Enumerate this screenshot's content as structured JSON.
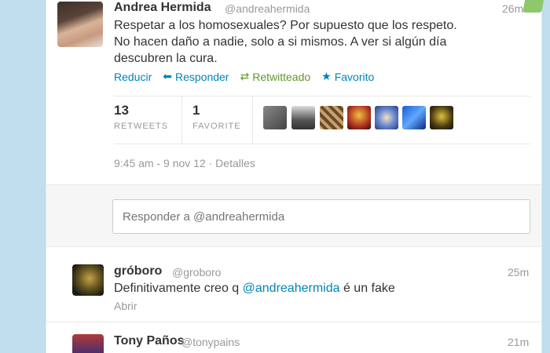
{
  "main_tweet": {
    "name": "Andrea Hermida",
    "handle": "@andreahermida",
    "time": "26m",
    "text_line1": "Respetar a los homosexuales? Por supuesto que los respeto.",
    "text_line2": "No hacen daño a nadie, solo a si mismos. A ver si algún día",
    "text_line3": "descubren la cura.",
    "actions": {
      "collapse": "Reducir",
      "reply": "Responder",
      "retweeted": "Retwitteado",
      "favorite": "Favorito"
    },
    "stats": {
      "retweets_count": "13",
      "retweets_label": "RETWEETS",
      "favorites_count": "1",
      "favorites_label": "FAVORITE"
    },
    "meta": "9:45 am - 9 nov 12 · Detalles"
  },
  "reply_box": {
    "placeholder": "Responder a @andreahermida"
  },
  "replies": [
    {
      "name": "gróboro",
      "handle": "@groboro",
      "time": "25m",
      "text_before": "Definitivamente creo q ",
      "mention": "@andreahermida",
      "text_after": " é un fake",
      "open": "Abrir"
    },
    {
      "name": "Tony Paños",
      "handle": "@tonypains",
      "time": "21m"
    }
  ],
  "colors": {
    "background": "#c0deed",
    "link": "#0084b4",
    "retweet_green": "#609928"
  },
  "icons": {
    "reply": "reply-arrow-icon",
    "retweet": "retweet-icon",
    "favorite": "star-icon"
  }
}
